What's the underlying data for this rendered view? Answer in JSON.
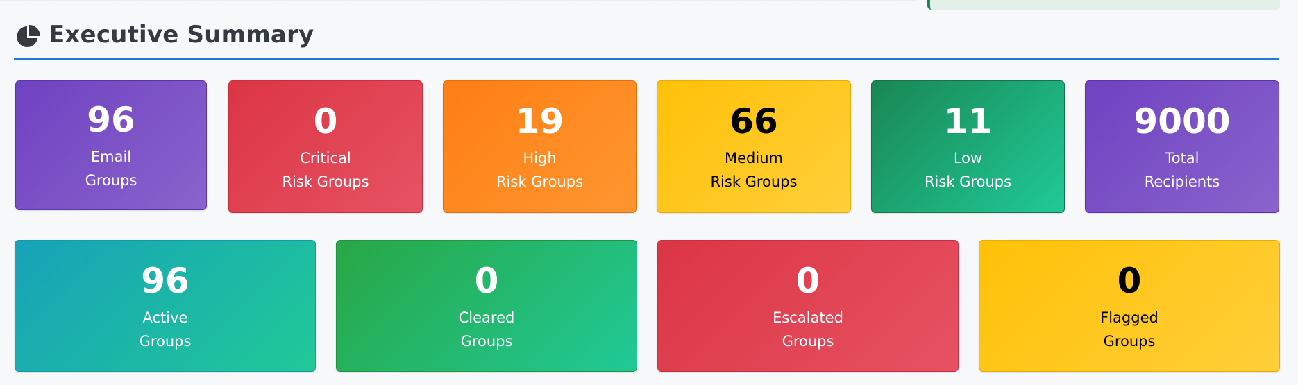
{
  "section": {
    "title": "Executive Summary",
    "icon": "pie-chart-icon"
  },
  "risk_cards": [
    {
      "value": "96",
      "line1": "Email",
      "line2": "Groups"
    },
    {
      "value": "0",
      "line1": "Critical",
      "line2": "Risk Groups"
    },
    {
      "value": "19",
      "line1": "High",
      "line2": "Risk Groups"
    },
    {
      "value": "66",
      "line1": "Medium",
      "line2": "Risk Groups"
    },
    {
      "value": "11",
      "line1": "Low",
      "line2": "Risk Groups"
    },
    {
      "value": "9000",
      "line1": "Total",
      "line2": "Recipients"
    }
  ],
  "status_cards": [
    {
      "value": "96",
      "line1": "Active",
      "line2": "Groups"
    },
    {
      "value": "0",
      "line1": "Cleared",
      "line2": "Groups"
    },
    {
      "value": "0",
      "line1": "Escalated",
      "line2": "Groups"
    },
    {
      "value": "0",
      "line1": "Flagged",
      "line2": "Groups"
    }
  ],
  "colors": {
    "purple": "#6f42c1",
    "critical": "#dc3545",
    "high": "#fd7e14",
    "medium": "#ffc107",
    "low": "#198754",
    "active": "#17a2b8",
    "cleared": "#28a745",
    "header_rule": "#1c7ed6"
  }
}
